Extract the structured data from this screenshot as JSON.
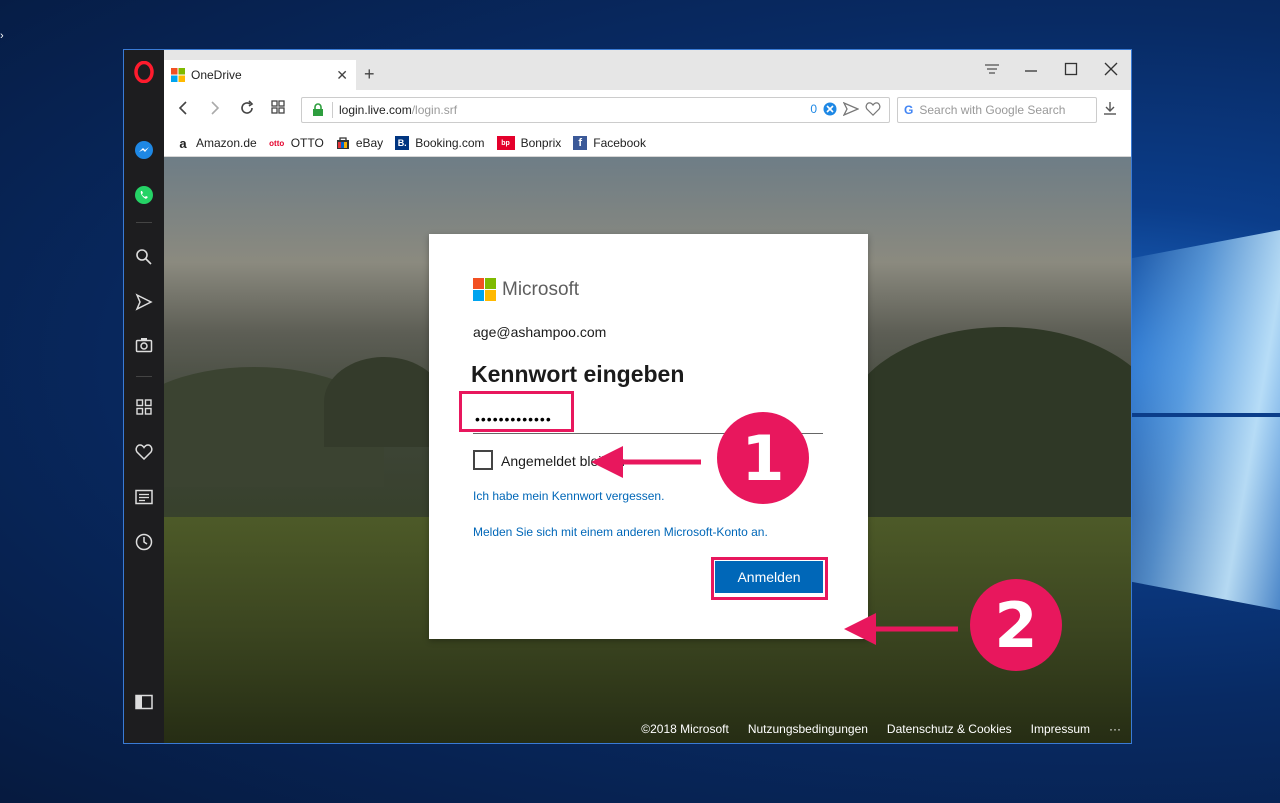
{
  "browser": {
    "tab_title": "OneDrive",
    "url_host": "login.live.com",
    "url_path": "/login.srf",
    "url_badge_count": "0",
    "search_placeholder": "Search with Google Search",
    "bookmarks": [
      {
        "label": "Amazon.de",
        "icon": "amazon-icon",
        "color": "#222222",
        "glyph": "a"
      },
      {
        "label": "OTTO",
        "icon": "otto-icon",
        "color": "#e4002b",
        "glyph": "otto"
      },
      {
        "label": "eBay",
        "icon": "ebay-icon",
        "color": "#222222",
        "glyph": "e"
      },
      {
        "label": "Booking.com",
        "icon": "booking-icon",
        "color": "#003580",
        "glyph": "B."
      },
      {
        "label": "Bonprix",
        "icon": "bonprix-icon",
        "color": "#e4002b",
        "glyph": "bp"
      },
      {
        "label": "Facebook",
        "icon": "facebook-icon",
        "color": "#3b5998",
        "glyph": "f"
      }
    ]
  },
  "login": {
    "brand": "Microsoft",
    "identity": "age@ashampoo.com",
    "heading": "Kennwort eingeben",
    "password_value": "•••••••••••••",
    "remember_label": "Angemeldet bleiben",
    "forgot_link": "Ich habe mein Kennwort vergessen.",
    "other_account_link": "Melden Sie sich mit einem anderen Microsoft-Konto an.",
    "submit_label": "Anmelden"
  },
  "footer": {
    "copyright": "©2018 Microsoft",
    "terms": "Nutzungsbedingungen",
    "privacy": "Datenschutz & Cookies",
    "imprint": "Impressum",
    "more": "···"
  },
  "annotations": {
    "step1": "1",
    "step2": "2",
    "color": "#e8175d"
  }
}
